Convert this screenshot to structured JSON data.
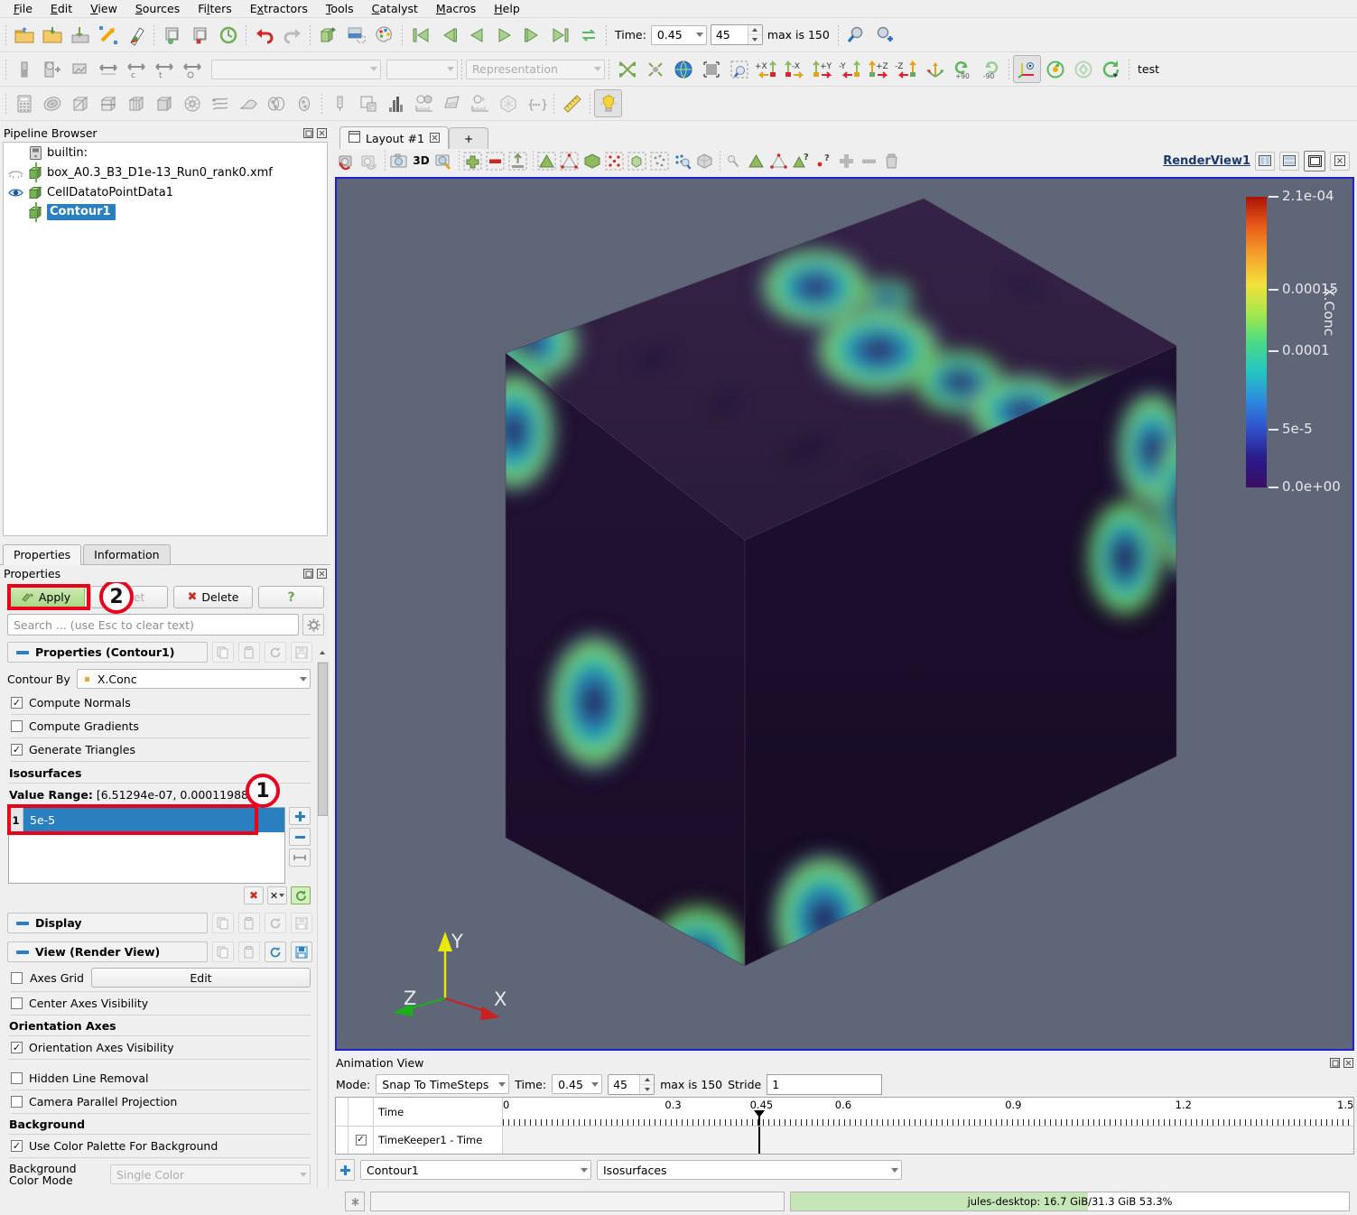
{
  "menubar": [
    "File",
    "Edit",
    "View",
    "Sources",
    "Filters",
    "Extractors",
    "Tools",
    "Catalyst",
    "Macros",
    "Help"
  ],
  "main_toolbar": {
    "time_label": "Time:",
    "time_value": "0.45",
    "frame_value": "45",
    "max_label": "max is 150"
  },
  "rep_toolbar": {
    "representation_placeholder": "Representation",
    "axis_buttons": [
      "+X",
      "-X",
      "+Y",
      "-Y",
      "+Z",
      "-Z"
    ],
    "rotate_plus": "+90",
    "rotate_minus": "-90",
    "macro_label": "test"
  },
  "pipeline": {
    "title": "Pipeline Browser",
    "items": [
      {
        "label": "builtin:",
        "icon": "server-icon",
        "eye": "none",
        "selected": false
      },
      {
        "label": "box_A0.3_B3_D1e-13_Run0_rank0.xmf",
        "icon": "source-icon",
        "eye": "hidden",
        "selected": false
      },
      {
        "label": "CellDatatoPointData1",
        "icon": "source-icon",
        "eye": "visible",
        "selected": false
      },
      {
        "label": "Contour1",
        "icon": "source-icon",
        "eye": "none",
        "selected": true
      }
    ]
  },
  "prop_tabs": [
    "Properties",
    "Information"
  ],
  "properties": {
    "title": "Properties",
    "apply_label": "Apply",
    "reset_label": "Reset",
    "delete_label": "Delete",
    "help_label": "?",
    "search_placeholder": "Search ... (use Esc to clear text)",
    "section_properties": "Properties (Contour1)",
    "contour_by_label": "Contour By",
    "contour_by_value": "X.Conc",
    "checks": [
      {
        "label": "Compute Normals",
        "checked": true
      },
      {
        "label": "Compute Gradients",
        "checked": false
      },
      {
        "label": "Generate Triangles",
        "checked": true
      }
    ],
    "isosurfaces_label": "Isosurfaces",
    "value_range_label": "Value Range:",
    "value_range_value": "[6.51294e-07, 0.000119884",
    "isovalue_index": "1",
    "isovalue": "5e-5",
    "section_display": "Display",
    "section_view": "View (Render View)",
    "axes_grid_label": "Axes Grid",
    "axes_grid_checked": false,
    "edit_label": "Edit",
    "center_axes_label": "Center Axes Visibility",
    "center_axes_checked": false,
    "orientation_axes_header": "Orientation Axes",
    "orientation_axes_label": "Orientation Axes Visibility",
    "orientation_axes_checked": true,
    "hidden_line_label": "Hidden Line Removal",
    "hidden_line_checked": false,
    "camera_parallel_label": "Camera Parallel Projection",
    "camera_parallel_checked": false,
    "background_header": "Background",
    "use_palette_label": "Use Color Palette For Background",
    "use_palette_checked": true,
    "bg_color_mode_label": "Background Color Mode",
    "bg_color_mode_value": "Single Color",
    "background_label": "Background"
  },
  "annotations": [
    {
      "id": "1",
      "text": "1"
    },
    {
      "id": "2",
      "text": "2"
    }
  ],
  "layout": {
    "tab_label": "Layout #1",
    "plus_label": "+",
    "view_name": "RenderView1",
    "threed_label": "3D"
  },
  "colorbar": {
    "title": "X.Conc",
    "ticks": [
      "2.1e-04",
      "0.00015",
      "0.0001",
      "5e-5",
      "0.0e+00"
    ],
    "tick_fracs": [
      0.0,
      0.32,
      0.53,
      0.8,
      1.0
    ],
    "gradient": [
      "#3b0f63",
      "#2a1a8a",
      "#3050c8",
      "#2e8ae0",
      "#24c6c0",
      "#4bdb86",
      "#a8e84a",
      "#f2e13a",
      "#f6a12a",
      "#e95b18",
      "#aa1203"
    ]
  },
  "orientation_axes": {
    "x": "X",
    "y": "Y",
    "z": "Z"
  },
  "animation": {
    "title": "Animation View",
    "mode_label": "Mode:",
    "mode_value": "Snap To TimeSteps",
    "time_label": "Time:",
    "time_value": "0.45",
    "frame_value": "45",
    "max_label": "max is 150",
    "stride_label": "Stride",
    "stride_value": "1",
    "col_time_label": "Time",
    "track_label": "TimeKeeper1 - Time",
    "track_checked": true,
    "axis_ticks": [
      "0",
      "0.3",
      "0.45",
      "0.6",
      "0.9",
      "1.2",
      "1.5"
    ],
    "axis_tick_fracs": [
      0.0,
      0.2,
      0.3,
      0.4,
      0.6,
      0.8,
      1.0
    ],
    "cursor_frac": 0.3,
    "source_value": "Contour1",
    "property_value": "Isosurfaces"
  },
  "statusbar": {
    "memory_text": "jules-desktop: 16.7 GiB/31.3 GiB 53.3%",
    "memory_percent": 53.3
  }
}
